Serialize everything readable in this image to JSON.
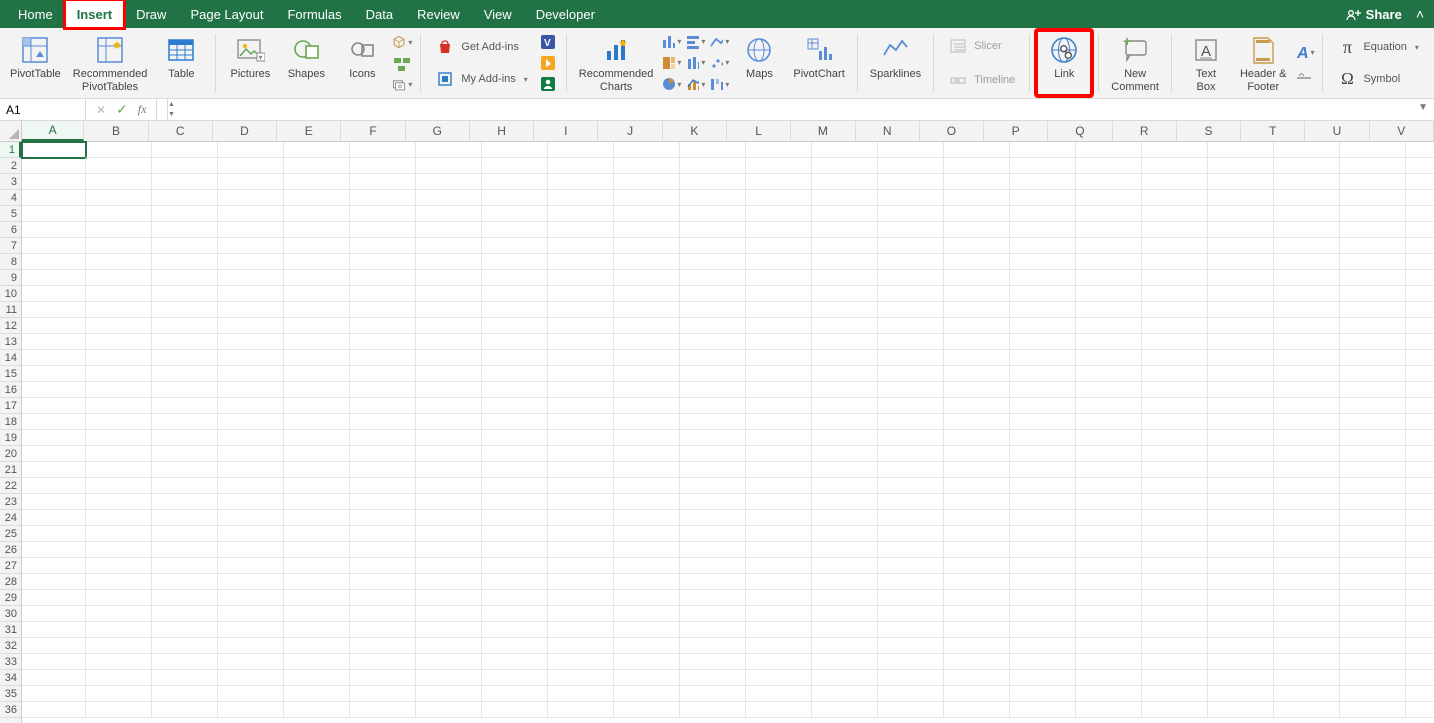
{
  "tabs": {
    "items": [
      "Home",
      "Insert",
      "Draw",
      "Page Layout",
      "Formulas",
      "Data",
      "Review",
      "View",
      "Developer"
    ],
    "active": "Insert",
    "share_label": "Share"
  },
  "ribbon": {
    "pivot_table": "PivotTable",
    "recommended_pivot": "Recommended\nPivotTables",
    "table": "Table",
    "pictures": "Pictures",
    "shapes": "Shapes",
    "icons": "Icons",
    "get_addins": "Get Add-ins",
    "my_addins": "My Add-ins",
    "recommended_charts": "Recommended\nCharts",
    "maps": "Maps",
    "pivot_chart": "PivotChart",
    "sparklines": "Sparklines",
    "slicer": "Slicer",
    "timeline": "Timeline",
    "link": "Link",
    "new_comment": "New\nComment",
    "text_box": "Text\nBox",
    "header_footer": "Header &\nFooter",
    "equation": "Equation",
    "symbol": "Symbol"
  },
  "fx": {
    "name_box_value": "A1",
    "fx_label": "fx"
  },
  "grid": {
    "columns": [
      "A",
      "B",
      "C",
      "D",
      "E",
      "F",
      "G",
      "H",
      "I",
      "J",
      "K",
      "L",
      "M",
      "N",
      "O",
      "P",
      "Q",
      "R",
      "S",
      "T",
      "U",
      "V"
    ],
    "row_count": 36,
    "active_cell": "A1"
  }
}
